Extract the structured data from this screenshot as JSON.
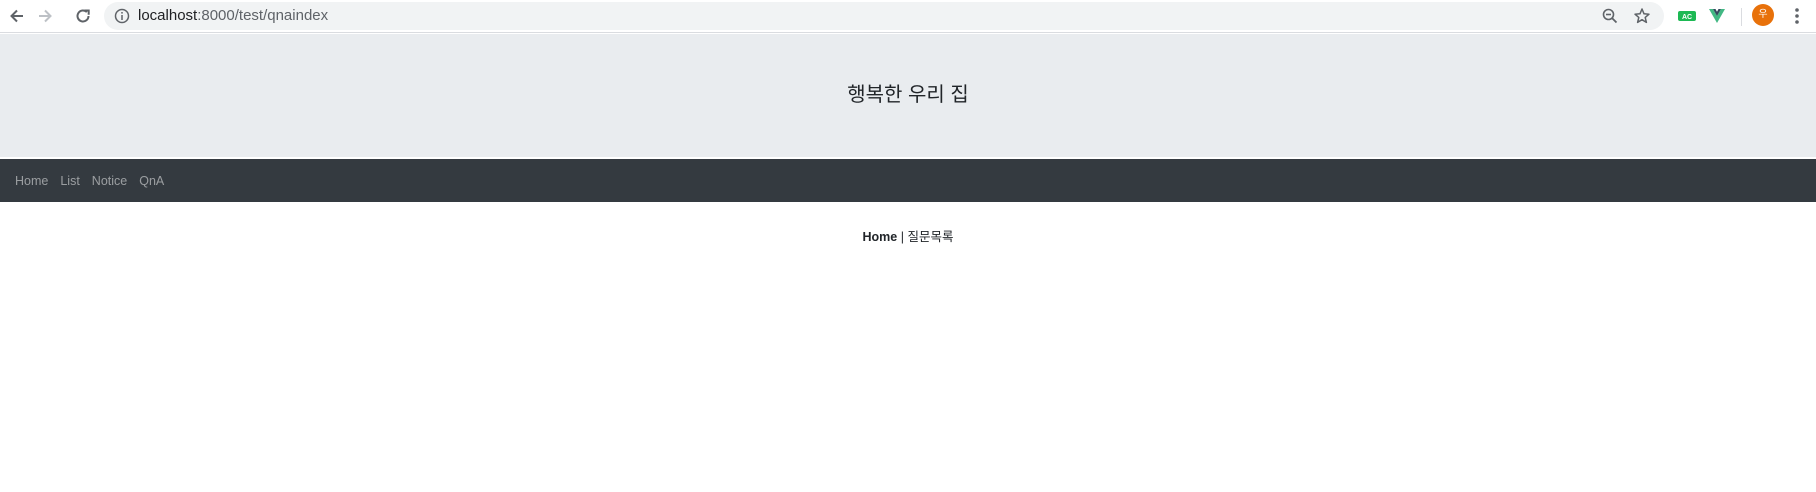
{
  "browser": {
    "url_host": "localhost",
    "url_path": ":8000/test/qnaindex",
    "icons": {
      "back": "arrow-left-icon",
      "forward": "arrow-right-icon",
      "reload": "reload-icon",
      "info": "info-icon",
      "zoom": "zoom-out-icon",
      "bookmark": "star-icon",
      "menu": "kebab-menu-icon"
    },
    "extensions": {
      "ac_label": "AC",
      "vue_label": "V"
    },
    "avatar_initial": "우"
  },
  "page": {
    "jumbotron_title": "행복한 우리 집",
    "nav": [
      {
        "label": "Home"
      },
      {
        "label": "List"
      },
      {
        "label": "Notice"
      },
      {
        "label": "QnA"
      }
    ],
    "breadcrumb": {
      "home": "Home",
      "separator": " | ",
      "current": "질문목록"
    }
  },
  "colors": {
    "jumbotron_bg": "#e9ecef",
    "navbar_bg": "#343a40",
    "avatar_bg": "#e8710a"
  }
}
